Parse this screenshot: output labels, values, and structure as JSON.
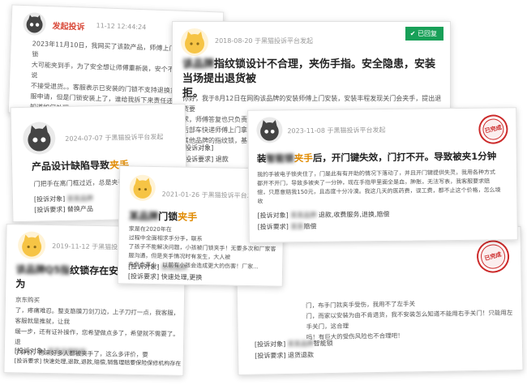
{
  "colors": {
    "accent_orange": "#e08a00",
    "replied_green": "#18a058",
    "stamp_red": "#cc2a2a",
    "author_red": "#d94a3a"
  },
  "card1": {
    "author": "发起投诉",
    "time": "11-12 12:44:24",
    "lines": [
      "2023年11月10日，我网买了该款产品，师傅上门安装后，指纹锁",
      "大可能夹到手，为了安全想让师傅重新装，安个不夹手的，结果说",
      "不接受退货。。客服表示已安装的门锁不支持退换货，",
      "服申请，但是门锁安装上了，谁给我拆下来责任还是",
      "知道如何处理。"
    ]
  },
  "card2": {
    "time": "2018-08-20 于黑猫投诉平台发起",
    "badge": "已回复",
    "title_a": "该品牌",
    "title_b": "指纹锁设计不合理，夹伤手指。安全隐患，安装当场提出退货被",
    "title_c": "拒。",
    "lines": [
      "你好，我于8月12日在网购该品牌的安装师傅上门安装，安装丰程发现关门会夹手，提出退货要",
      "求，师傅答复也只负责安装，",
      "后部车快递师傅上门拿",
      "其他品牌的指纹锁，基本上"
    ],
    "object_label": "[投诉对象]",
    "request_label": "[投诉要求]",
    "request_value": "退款"
  },
  "card3": {
    "time": "2024-07-07 于黑猫投诉平台发起",
    "title_a": "产品设计缺陷导致",
    "title_hl": "夹手",
    "line": "门把手在离门框过近，总是夹手，两",
    "object_label": "[投诉对象]",
    "request_label": "[投诉要求]",
    "request_value": "替换产品"
  },
  "card4": {
    "time": "2019-11-12 于黑猫投诉平台发起",
    "title_a": "该品牌Q5指",
    "title_b": "纹锁存在安全",
    "title_c": "为",
    "lines": [
      "京东购买",
      "了，疼痛难忍。整支筋膜刀剑刀边，上子刀打一点，我客服，客服就是推就，让我",
      "缓一步，还有证补操作，您希望做点多了，希望就不需要了。退",
      "了评价，愿来好多人都被夹手了，这么多评价，要"
    ],
    "object_label": "[投诉对象]",
    "request_label": "[投诉要求]",
    "request_value": "快速处理,退款,退款,赔偿,销售理赔要保险保修机构存在"
  },
  "card5": {
    "time": "2021-01-26 于黑猫投诉平台发起",
    "title_a": "某品牌",
    "title_b": "门锁",
    "title_hl": "夹手",
    "lines": [
      "家是在2020年在",
      "过程中全面相求手分手，联系",
      "了孩子不能解决问题，小孩被门锁夹手！无要多次和厂家客服沟通，但是夹手情况时有发生，大人被",
      "夹伤血事小，以前有小孩会造成更大的伤害！厂家..."
    ],
    "object_label": "[投诉对象]",
    "request_label": "[投诉要求]",
    "request_value": "快速处理,更换"
  },
  "card6": {
    "time": "2023-11-08 于黑猫投诉平台发起",
    "stamp": "已完成",
    "title_a": "装",
    "title_b": "智能锁",
    "title_hl": "夹手",
    "title_c": "后，开门键失效，门打不开。导致被夹1分钟",
    "lines": [
      "我的手被电子锁夹住了，门是此有有开助的情况下落动了，并且开门键提供失灵，我用各种方式",
      "都开不开门，导致多被夹了一分钟，现在手指甲里面全是血，肿胀，无法写表，我客服要求赔",
      "偿，只愿意赔我150元，且态度十分冷漠。我这几天的医药费，误工费，都不止这个价格，怎么境",
      "收"
    ],
    "object_label": "[投诉对象]",
    "object_value": "退款,收费服务,退换,赔偿",
    "request_label": "[投诉要求]",
    "request_value": "赔偿"
  },
  "card7": {
    "stamp": "已完成",
    "lines": [
      "门，布手门就夹手受伤，我用不了左手关",
      "门，而家以安装为由不肯退货，我不安装怎么知道不能用右手关门！只能用左手关门，这合理",
      "吗！有巨大的受伤风险也不合理吧！"
    ],
    "object_label": "[投诉对象]",
    "object_value": "智能锁",
    "request_label": "[投诉要求]",
    "request_value": "退货退款"
  }
}
